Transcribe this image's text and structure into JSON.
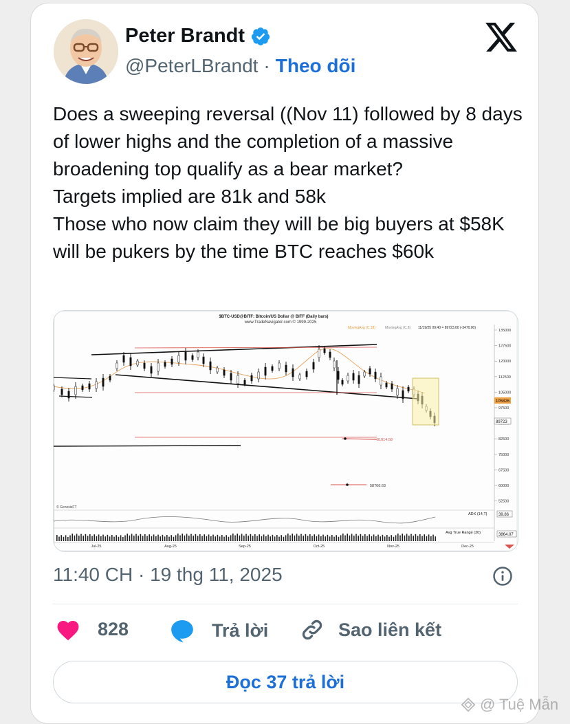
{
  "author": {
    "name": "Peter Brandt",
    "handle": "@PeterLBrandt",
    "separator": "·",
    "follow_label": "Theo dõi"
  },
  "tweet": {
    "text": "Does a sweeping reversal ((Nov 11) followed by 8 days of lower highs and the completion of a massive broadening top qualify as a bear market?\nTargets implied are 81k and 58k\nThose who now claim they will be big buyers at $58K will be pukers by the time BTC reaches $60k",
    "timestamp": "11:40 CH · 19 thg 11, 2025"
  },
  "chart": {
    "title": "$BTC-USD@BITF:  Bitcoin/US Dollar @ BITF  (Daily bars)",
    "source": "www.TradeNavigator.com © 1999-2025",
    "ma_label_1": "MovingAvg (C,18)",
    "ma_label_2": "MovingAvg (C,8)",
    "quote": "11/19/25 09:40 = 89723.00 (-3470.00)",
    "price_ticks": [
      "135000",
      "127500",
      "120000",
      "112500",
      "105000",
      "97500",
      "90000",
      "82500",
      "75000",
      "67500",
      "60000",
      "52500"
    ],
    "last_price_tag": "105826",
    "current_price_tag": "89723",
    "target_1": "81014.58",
    "target_2": "58706.63",
    "genesis": "© GenesisFT",
    "adx_label": "ADX (14,T)",
    "adx_value": "39.86",
    "atr_label": "Avg True Range (30)",
    "atr_value": "3864.07",
    "months": [
      "Jul-25",
      "Aug-25",
      "Sep-25",
      "Oct-25",
      "Nov-25",
      "Dec-25"
    ]
  },
  "actions": {
    "like_count": "828",
    "reply_label": "Trả lời",
    "copy_link_label": "Sao liên kết",
    "read_replies_label": "Đọc 37 trả lời"
  },
  "watermark": "@ Tuệ Mẫn",
  "colors": {
    "accent": "#1d6fd8",
    "like": "#f91880",
    "reply_icon": "#1d9bf0",
    "target_line": "#d9534f"
  }
}
